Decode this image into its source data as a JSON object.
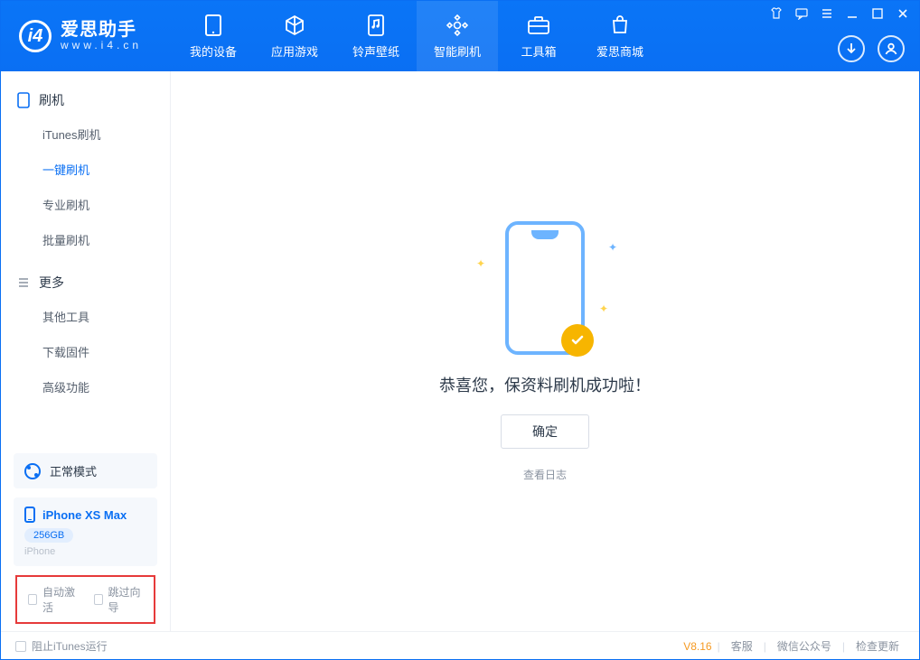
{
  "app": {
    "name_cn": "爱思助手",
    "url": "www.i4.cn"
  },
  "nav": [
    {
      "label": "我的设备",
      "icon": "device-icon"
    },
    {
      "label": "应用游戏",
      "icon": "cube-icon"
    },
    {
      "label": "铃声壁纸",
      "icon": "ringtone-icon"
    },
    {
      "label": "智能刷机",
      "icon": "flash-icon",
      "active": true
    },
    {
      "label": "工具箱",
      "icon": "toolbox-icon"
    },
    {
      "label": "爱思商城",
      "icon": "store-icon"
    }
  ],
  "sidebar": {
    "group1": {
      "title": "刷机",
      "items": [
        "iTunes刷机",
        "一键刷机",
        "专业刷机",
        "批量刷机"
      ],
      "active_index": 1
    },
    "group2": {
      "title": "更多",
      "items": [
        "其他工具",
        "下载固件",
        "高级功能"
      ]
    }
  },
  "mode": {
    "label": "正常模式"
  },
  "device": {
    "name": "iPhone XS Max",
    "capacity": "256GB",
    "type": "iPhone"
  },
  "options": {
    "auto_activate": "自动激活",
    "skip_guide": "跳过向导"
  },
  "main": {
    "success_msg": "恭喜您，保资料刷机成功啦！",
    "ok_btn": "确定",
    "view_log": "查看日志"
  },
  "footer": {
    "block_itunes": "阻止iTunes运行",
    "version": "V8.16",
    "links": [
      "客服",
      "微信公众号",
      "检查更新"
    ]
  }
}
